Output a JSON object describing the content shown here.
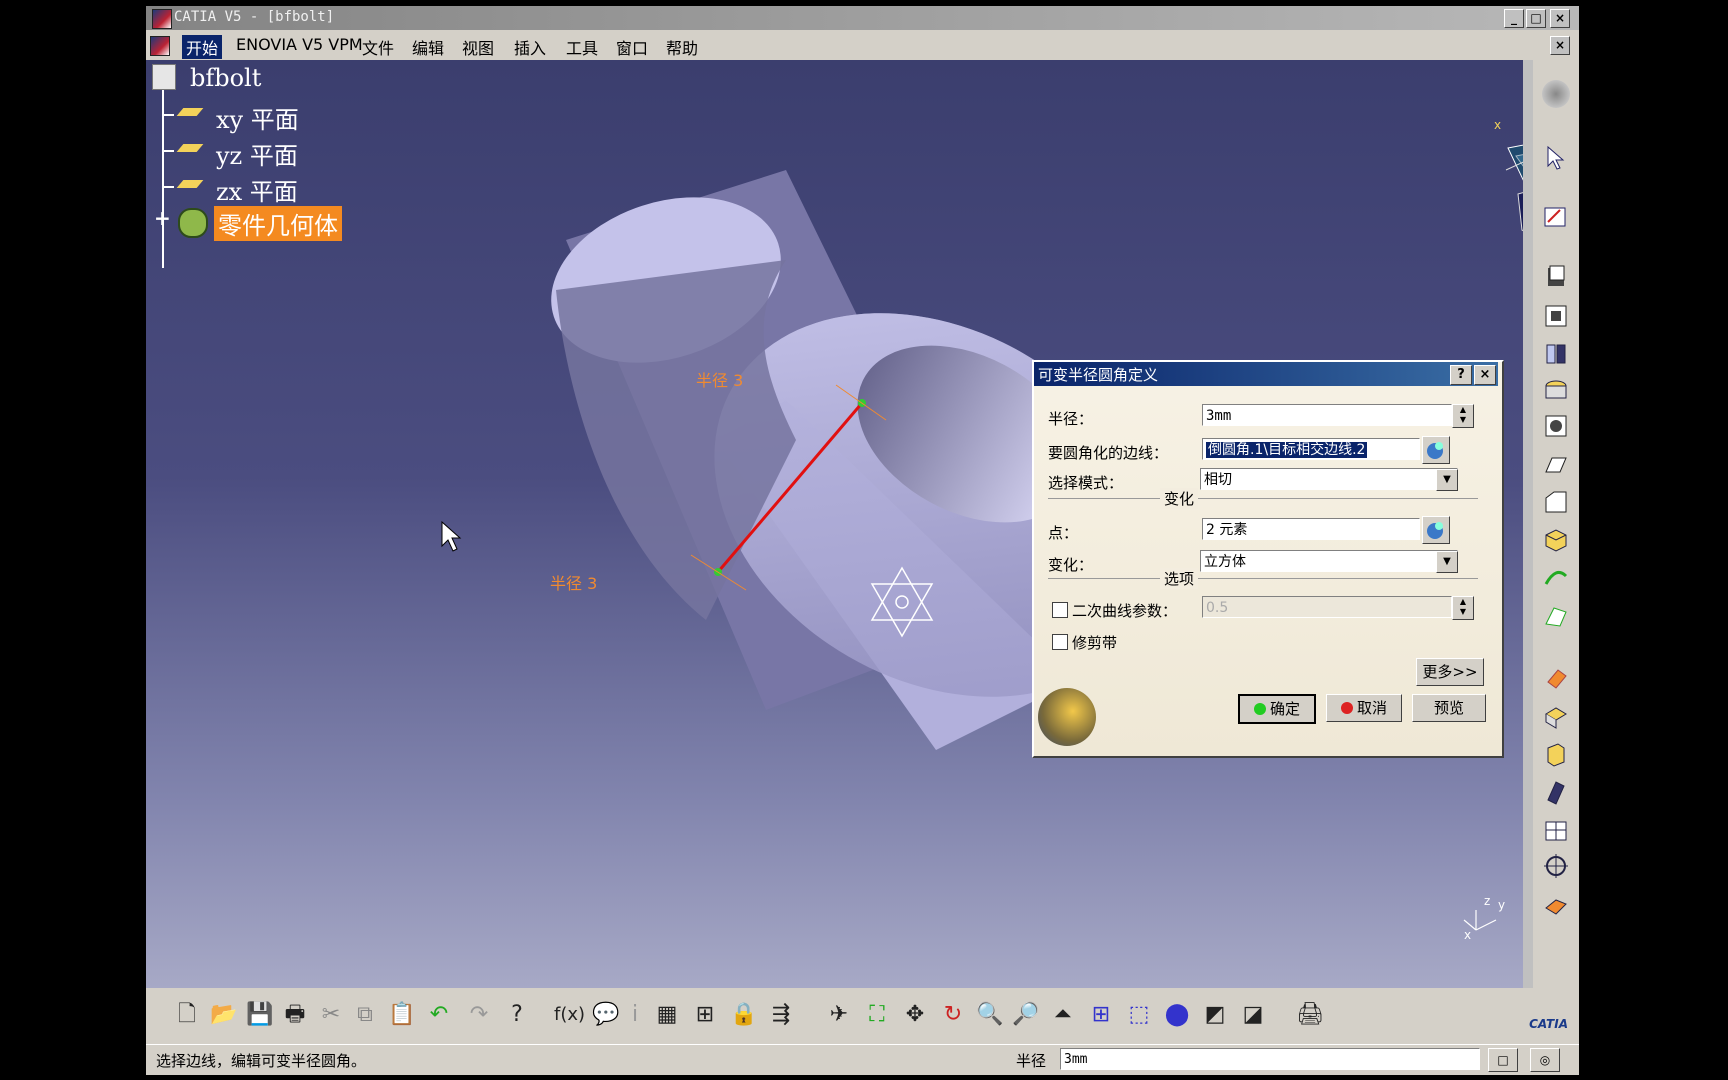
{
  "window": {
    "title": "CATIA V5 - [bfbolt]"
  },
  "menu": [
    "开始",
    "ENOVIA V5 VPM",
    "文件",
    "编辑",
    "视图",
    "插入",
    "工具",
    "窗口",
    "帮助"
  ],
  "tree": {
    "root": "bfbolt",
    "items": [
      "xy 平面",
      "yz 平面",
      "zx 平面"
    ],
    "selected": "零件几何体"
  },
  "viewport": {
    "point_labels": [
      "半径",
      "3",
      "半径",
      "3"
    ],
    "axis_labels": [
      "x",
      "y",
      "z"
    ]
  },
  "dialog": {
    "title": "可变半径圆角定义",
    "radius_label": "半径：",
    "radius_value": "3mm",
    "edges_label": "要圆角化的边线：",
    "edges_value": "倒圆角.1\\目标相交边线.2",
    "mode_label": "选择模式：",
    "mode_value": "相切",
    "section_variation": "变化",
    "points_label": "点：",
    "points_value": "2 元素",
    "variation_label": "变化：",
    "variation_value": "立方体",
    "section_options": "选项",
    "conic_label": "二次曲线参数：",
    "conic_value": "0.5",
    "trim_label": "修剪带",
    "more_button": "更多>>",
    "ok_button": "确定",
    "cancel_button": "取消",
    "preview_button": "预览"
  },
  "status": {
    "message": "选择边线，编辑可变半径圆角。",
    "field_label": "半径",
    "field_value": "3mm"
  },
  "colors": {
    "selection": "#f48a20",
    "title_active": "#0a246a",
    "edge_highlight": "#e11010"
  }
}
